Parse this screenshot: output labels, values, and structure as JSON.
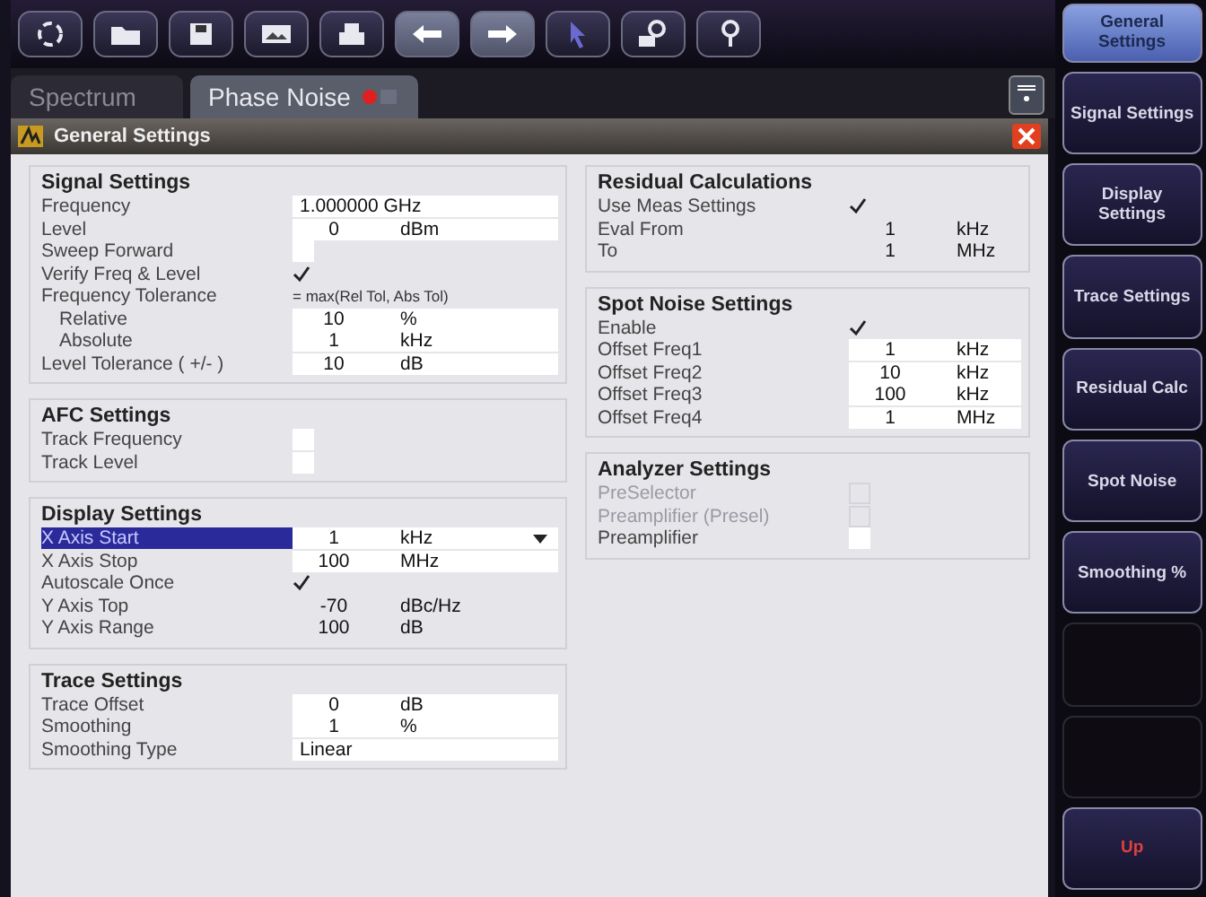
{
  "tabs": [
    {
      "label": "Spectrum",
      "selected": false
    },
    {
      "label": "Phase Noise",
      "selected": true
    }
  ],
  "dialog": {
    "title": "General Settings"
  },
  "columns": [
    [
      {
        "title": "Signal Settings",
        "rows": [
          {
            "kind": "value",
            "label": "Frequency",
            "value": "1.000000 GHz",
            "unit": "",
            "editable": true,
            "selected": false
          },
          {
            "kind": "value",
            "label": "Level",
            "value": "0",
            "unit": "dBm",
            "editable": true,
            "selected": false
          },
          {
            "kind": "checkbox",
            "label": "Sweep Forward",
            "checked": false,
            "disabled": false,
            "selected": false
          },
          {
            "kind": "checkbox",
            "label": "Verify Freq & Level",
            "checked": true,
            "disabled": false,
            "selected": false
          },
          {
            "kind": "note",
            "label": "Frequency Tolerance",
            "note": "= max(Rel Tol, Abs Tol)",
            "selected": false,
            "children": [
              {
                "kind": "value",
                "label": "Relative",
                "value": "10",
                "unit": "%",
                "editable": true,
                "selected": false
              },
              {
                "kind": "value",
                "label": "Absolute",
                "value": "1",
                "unit": "kHz",
                "editable": true,
                "selected": false
              }
            ]
          },
          {
            "kind": "value",
            "label": "Level Tolerance ( +/- )",
            "value": "10",
            "unit": "dB",
            "editable": true,
            "selected": false
          }
        ]
      },
      {
        "title": "AFC Settings",
        "rows": [
          {
            "kind": "checkbox",
            "label": "Track Frequency",
            "checked": false,
            "disabled": false,
            "selected": false
          },
          {
            "kind": "checkbox",
            "label": "Track Level",
            "checked": false,
            "disabled": false,
            "selected": false
          }
        ]
      },
      {
        "title": "Display Settings",
        "rows": [
          {
            "kind": "dropdown",
            "label": "X Axis Start",
            "value": "1",
            "unit": "kHz",
            "editable": true,
            "selected": true
          },
          {
            "kind": "value",
            "label": "X Axis Stop",
            "value": "100",
            "unit": "MHz",
            "editable": true,
            "selected": false
          },
          {
            "kind": "checkbox",
            "label": "Autoscale Once",
            "checked": true,
            "disabled": false,
            "selected": false
          },
          {
            "kind": "value",
            "label": "Y Axis Top",
            "value": "-70",
            "unit": "dBc/Hz",
            "editable": false,
            "selected": false
          },
          {
            "kind": "value",
            "label": "Y Axis Range",
            "value": "100",
            "unit": "dB",
            "editable": false,
            "selected": false
          }
        ]
      },
      {
        "title": "Trace Settings",
        "rows": [
          {
            "kind": "value",
            "label": "Trace Offset",
            "value": "0",
            "unit": "dB",
            "editable": true,
            "selected": false
          },
          {
            "kind": "value",
            "label": "Smoothing",
            "value": "1",
            "unit": "%",
            "editable": true,
            "selected": false
          },
          {
            "kind": "value",
            "label": "Smoothing Type",
            "value": "Linear",
            "unit": "",
            "editable": true,
            "selected": false
          }
        ]
      }
    ],
    [
      {
        "title": "Residual Calculations",
        "rows": [
          {
            "kind": "checkbox",
            "label": "Use Meas Settings",
            "checked": true,
            "disabled": false,
            "selected": false
          },
          {
            "kind": "value",
            "label": "Eval From",
            "value": "1",
            "unit": "kHz",
            "editable": false,
            "selected": false
          },
          {
            "kind": "value",
            "label": "To",
            "value": "1",
            "unit": "MHz",
            "editable": false,
            "selected": false
          }
        ]
      },
      {
        "title": "Spot Noise Settings",
        "rows": [
          {
            "kind": "checkbox",
            "label": "Enable",
            "checked": true,
            "disabled": false,
            "selected": false
          },
          {
            "kind": "value",
            "label": "Offset Freq1",
            "value": "1",
            "unit": "kHz",
            "editable": true,
            "selected": false
          },
          {
            "kind": "value",
            "label": "Offset Freq2",
            "value": "10",
            "unit": "kHz",
            "editable": true,
            "selected": false
          },
          {
            "kind": "value",
            "label": "Offset Freq3",
            "value": "100",
            "unit": "kHz",
            "editable": true,
            "selected": false
          },
          {
            "kind": "value",
            "label": "Offset Freq4",
            "value": "1",
            "unit": "MHz",
            "editable": true,
            "selected": false
          }
        ]
      },
      {
        "title": "Analyzer Settings",
        "rows": [
          {
            "kind": "checkbox",
            "label": "PreSelector",
            "checked": false,
            "disabled": true,
            "selected": false
          },
          {
            "kind": "checkbox",
            "label": "Preamplifier (Presel)",
            "checked": false,
            "disabled": true,
            "selected": false
          },
          {
            "kind": "checkbox",
            "label": "Preamplifier",
            "checked": false,
            "disabled": false,
            "selected": false
          }
        ]
      }
    ]
  ],
  "softkeys": [
    {
      "kind": "header",
      "label": "General Settings"
    },
    {
      "kind": "key",
      "label": "Signal Settings"
    },
    {
      "kind": "key",
      "label": "Display Settings"
    },
    {
      "kind": "key",
      "label": "Trace Settings"
    },
    {
      "kind": "key",
      "label": "Residual Calc"
    },
    {
      "kind": "key",
      "label": "Spot Noise"
    },
    {
      "kind": "key",
      "label": "Smoothing %"
    },
    {
      "kind": "blank"
    },
    {
      "kind": "blank"
    },
    {
      "kind": "nav",
      "label": "Up"
    }
  ]
}
